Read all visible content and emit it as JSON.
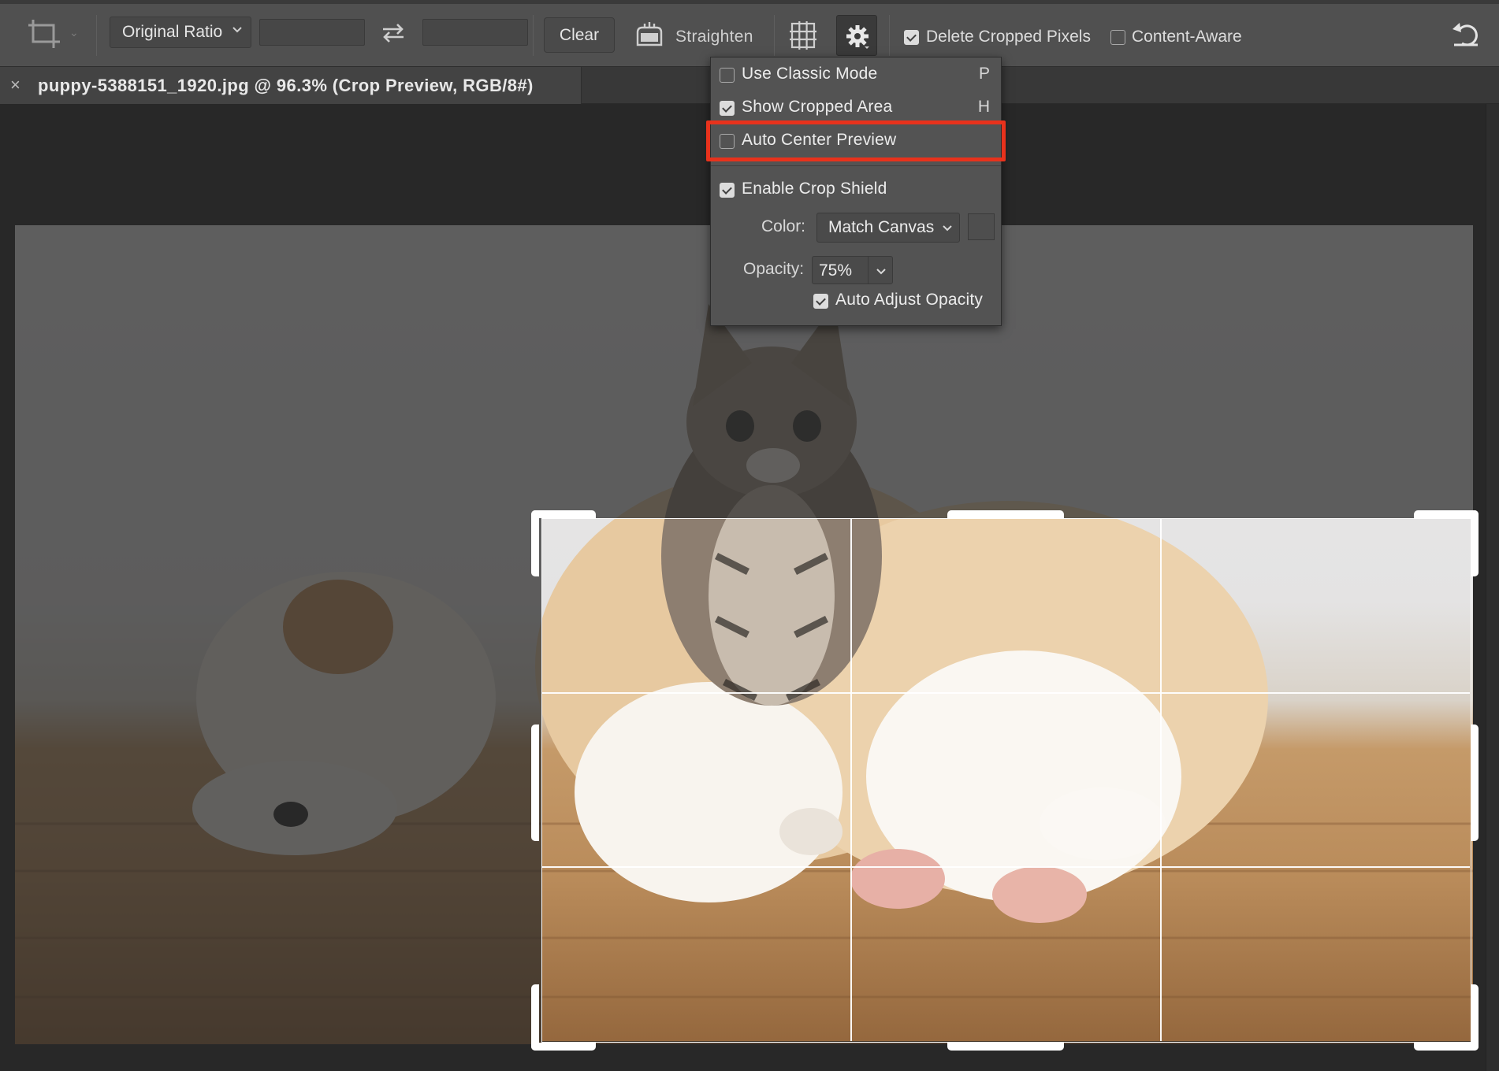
{
  "options_bar": {
    "tool_icon": "crop-tool-icon",
    "aspect_ratio": "Original Ratio",
    "width_value": "",
    "height_value": "",
    "swap_icon": "swap-arrows-icon",
    "clear_label": "Clear",
    "straighten_icon": "level-icon",
    "straighten_label": "Straighten",
    "overlay_icon": "grid-overlay-icon",
    "settings_icon": "gear-icon",
    "delete_cropped_label": "Delete Cropped Pixels",
    "delete_cropped_checked": true,
    "content_aware_label": "Content-Aware",
    "content_aware_checked": false,
    "reset_icon": "reset-icon"
  },
  "document_tab": {
    "title": "puppy-5388151_1920.jpg @ 96.3% (Crop Preview, RGB/8#)",
    "close_glyph": "×"
  },
  "crop_settings_menu": {
    "items": [
      {
        "label": "Use Classic Mode",
        "shortcut": "P",
        "checked": false
      },
      {
        "label": "Show Cropped Area",
        "shortcut": "H",
        "checked": true
      },
      {
        "label": "Auto Center Preview",
        "shortcut": "",
        "checked": false,
        "highlighted": true
      },
      {
        "label": "Enable Crop Shield",
        "shortcut": "",
        "checked": true
      }
    ],
    "color_label": "Color:",
    "color_value": "Match Canvas",
    "opacity_label": "Opacity:",
    "opacity_value": "75%",
    "auto_adjust_label": "Auto Adjust Opacity",
    "auto_adjust_checked": true
  },
  "colors": {
    "highlight": "#e8321c",
    "panel_bg": "#535353",
    "toolbar_bg": "#505050"
  }
}
